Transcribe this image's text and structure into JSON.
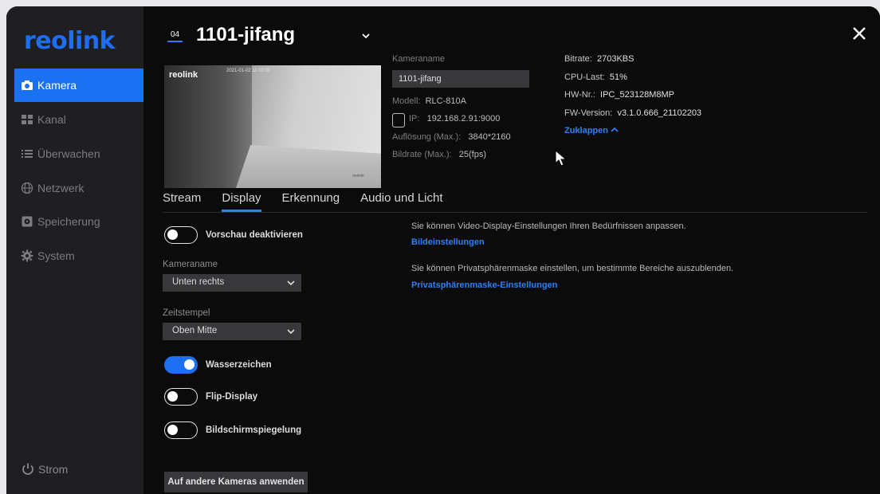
{
  "sidebar": {
    "logo": "reolink",
    "items": [
      {
        "label": "Kamera",
        "icon": "camera-icon",
        "active": true
      },
      {
        "label": "Kanal",
        "icon": "grid-icon",
        "active": false
      },
      {
        "label": "Überwachen",
        "icon": "list-icon",
        "active": false
      },
      {
        "label": "Netzwerk",
        "icon": "globe-icon",
        "active": false
      },
      {
        "label": "Speicherung",
        "icon": "storage-icon",
        "active": false
      },
      {
        "label": "System",
        "icon": "gear-icon",
        "active": false
      }
    ],
    "power_label": "Strom"
  },
  "header": {
    "channel": "04",
    "camera_title": "1101-jifang"
  },
  "preview": {
    "logo": "reolink",
    "stamp": "2021-01-02 11:00:00",
    "watermark": "reolink"
  },
  "info": {
    "name_label": "Kameraname",
    "name_value": "1101-jifang",
    "model_label": "Modell:",
    "model_value": "RLC-810A",
    "ip_label": "IP:",
    "ip_value": "192.168.2.91:9000",
    "resolution_label": "Auflösung (Max.):",
    "resolution_value": "3840*2160",
    "framerate_label": "Bildrate (Max.):",
    "framerate_value": "25(fps)",
    "bitrate_label": "Bitrate:",
    "bitrate_value": "2703KBS",
    "cpu_label": "CPU-Last:",
    "cpu_value": "51%",
    "hw_label": "HW-Nr.:",
    "hw_value": "IPC_523128M8MP",
    "fw_label": "FW-Version:",
    "fw_value": "v3.1.0.666_21102203",
    "collapse_label": "Zuklappen"
  },
  "tabs": [
    "Stream",
    "Display",
    "Erkennung",
    "Audio und Licht"
  ],
  "active_tab": "Display",
  "display": {
    "preview_toggle_label": "Vorschau deaktivieren",
    "camname_label": "Kameraname",
    "camname_value": "Unten rechts",
    "timestamp_label": "Zeitstempel",
    "timestamp_value": "Oben Mitte",
    "watermark_label": "Wasserzeichen",
    "flip_label": "Flip-Display",
    "mirror_label": "Bildschirmspiegelung",
    "apply_label": "Auf andere Kameras anwenden",
    "desc1": "Sie können Video-Display-Einstellungen Ihren Bedürfnissen anpassen.",
    "link1": "Bildeinstellungen",
    "desc2": "Sie können Privatsphärenmaske einstellen, um bestimmte Bereiche auszublenden.",
    "link2": "Privatsphärenmaske-Einstellungen"
  },
  "colors": {
    "accent": "#1a72f2",
    "sidebar_bg": "#1f1f21",
    "main_bg": "#0b0b0c"
  }
}
